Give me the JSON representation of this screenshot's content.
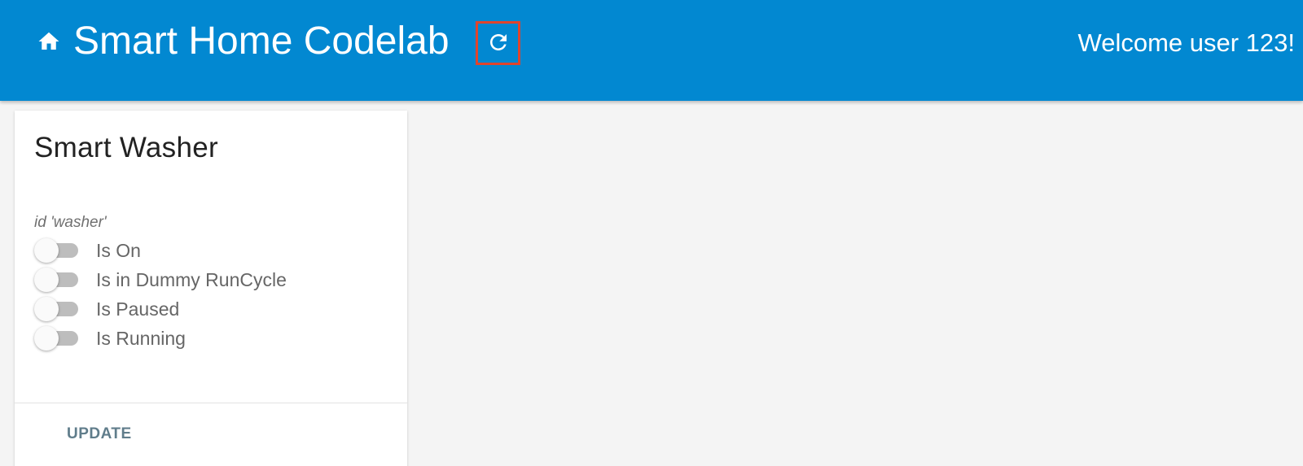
{
  "header": {
    "home_icon": "home-icon",
    "title": "Smart Home Codelab",
    "refresh_icon": "refresh-icon",
    "welcome": "Welcome user 123!",
    "background_color": "#0288d1",
    "highlight_color": "#e0442c"
  },
  "card": {
    "title": "Smart Washer",
    "device_id": "id 'washer'",
    "toggles": [
      {
        "label": "Is On",
        "checked": false
      },
      {
        "label": "Is in Dummy RunCycle",
        "checked": false
      },
      {
        "label": "Is Paused",
        "checked": false
      },
      {
        "label": "Is Running",
        "checked": false
      }
    ],
    "update_label": "UPDATE",
    "update_color": "#607d8b"
  }
}
